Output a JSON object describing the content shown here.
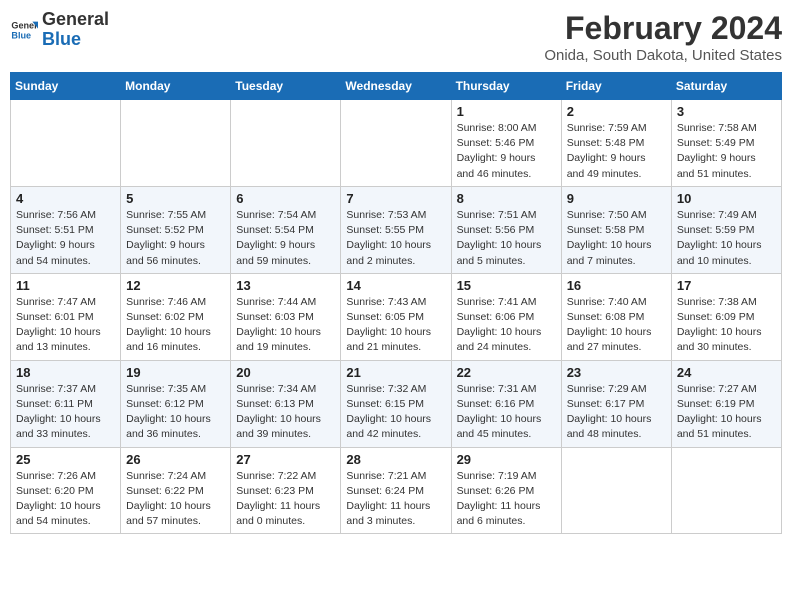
{
  "header": {
    "logo_line1": "General",
    "logo_line2": "Blue",
    "title": "February 2024",
    "subtitle": "Onida, South Dakota, United States"
  },
  "days_of_week": [
    "Sunday",
    "Monday",
    "Tuesday",
    "Wednesday",
    "Thursday",
    "Friday",
    "Saturday"
  ],
  "weeks": [
    [
      {
        "day": "",
        "info": ""
      },
      {
        "day": "",
        "info": ""
      },
      {
        "day": "",
        "info": ""
      },
      {
        "day": "",
        "info": ""
      },
      {
        "day": "1",
        "info": "Sunrise: 8:00 AM\nSunset: 5:46 PM\nDaylight: 9 hours\nand 46 minutes."
      },
      {
        "day": "2",
        "info": "Sunrise: 7:59 AM\nSunset: 5:48 PM\nDaylight: 9 hours\nand 49 minutes."
      },
      {
        "day": "3",
        "info": "Sunrise: 7:58 AM\nSunset: 5:49 PM\nDaylight: 9 hours\nand 51 minutes."
      }
    ],
    [
      {
        "day": "4",
        "info": "Sunrise: 7:56 AM\nSunset: 5:51 PM\nDaylight: 9 hours\nand 54 minutes."
      },
      {
        "day": "5",
        "info": "Sunrise: 7:55 AM\nSunset: 5:52 PM\nDaylight: 9 hours\nand 56 minutes."
      },
      {
        "day": "6",
        "info": "Sunrise: 7:54 AM\nSunset: 5:54 PM\nDaylight: 9 hours\nand 59 minutes."
      },
      {
        "day": "7",
        "info": "Sunrise: 7:53 AM\nSunset: 5:55 PM\nDaylight: 10 hours\nand 2 minutes."
      },
      {
        "day": "8",
        "info": "Sunrise: 7:51 AM\nSunset: 5:56 PM\nDaylight: 10 hours\nand 5 minutes."
      },
      {
        "day": "9",
        "info": "Sunrise: 7:50 AM\nSunset: 5:58 PM\nDaylight: 10 hours\nand 7 minutes."
      },
      {
        "day": "10",
        "info": "Sunrise: 7:49 AM\nSunset: 5:59 PM\nDaylight: 10 hours\nand 10 minutes."
      }
    ],
    [
      {
        "day": "11",
        "info": "Sunrise: 7:47 AM\nSunset: 6:01 PM\nDaylight: 10 hours\nand 13 minutes."
      },
      {
        "day": "12",
        "info": "Sunrise: 7:46 AM\nSunset: 6:02 PM\nDaylight: 10 hours\nand 16 minutes."
      },
      {
        "day": "13",
        "info": "Sunrise: 7:44 AM\nSunset: 6:03 PM\nDaylight: 10 hours\nand 19 minutes."
      },
      {
        "day": "14",
        "info": "Sunrise: 7:43 AM\nSunset: 6:05 PM\nDaylight: 10 hours\nand 21 minutes."
      },
      {
        "day": "15",
        "info": "Sunrise: 7:41 AM\nSunset: 6:06 PM\nDaylight: 10 hours\nand 24 minutes."
      },
      {
        "day": "16",
        "info": "Sunrise: 7:40 AM\nSunset: 6:08 PM\nDaylight: 10 hours\nand 27 minutes."
      },
      {
        "day": "17",
        "info": "Sunrise: 7:38 AM\nSunset: 6:09 PM\nDaylight: 10 hours\nand 30 minutes."
      }
    ],
    [
      {
        "day": "18",
        "info": "Sunrise: 7:37 AM\nSunset: 6:11 PM\nDaylight: 10 hours\nand 33 minutes."
      },
      {
        "day": "19",
        "info": "Sunrise: 7:35 AM\nSunset: 6:12 PM\nDaylight: 10 hours\nand 36 minutes."
      },
      {
        "day": "20",
        "info": "Sunrise: 7:34 AM\nSunset: 6:13 PM\nDaylight: 10 hours\nand 39 minutes."
      },
      {
        "day": "21",
        "info": "Sunrise: 7:32 AM\nSunset: 6:15 PM\nDaylight: 10 hours\nand 42 minutes."
      },
      {
        "day": "22",
        "info": "Sunrise: 7:31 AM\nSunset: 6:16 PM\nDaylight: 10 hours\nand 45 minutes."
      },
      {
        "day": "23",
        "info": "Sunrise: 7:29 AM\nSunset: 6:17 PM\nDaylight: 10 hours\nand 48 minutes."
      },
      {
        "day": "24",
        "info": "Sunrise: 7:27 AM\nSunset: 6:19 PM\nDaylight: 10 hours\nand 51 minutes."
      }
    ],
    [
      {
        "day": "25",
        "info": "Sunrise: 7:26 AM\nSunset: 6:20 PM\nDaylight: 10 hours\nand 54 minutes."
      },
      {
        "day": "26",
        "info": "Sunrise: 7:24 AM\nSunset: 6:22 PM\nDaylight: 10 hours\nand 57 minutes."
      },
      {
        "day": "27",
        "info": "Sunrise: 7:22 AM\nSunset: 6:23 PM\nDaylight: 11 hours\nand 0 minutes."
      },
      {
        "day": "28",
        "info": "Sunrise: 7:21 AM\nSunset: 6:24 PM\nDaylight: 11 hours\nand 3 minutes."
      },
      {
        "day": "29",
        "info": "Sunrise: 7:19 AM\nSunset: 6:26 PM\nDaylight: 11 hours\nand 6 minutes."
      },
      {
        "day": "",
        "info": ""
      },
      {
        "day": "",
        "info": ""
      }
    ]
  ]
}
